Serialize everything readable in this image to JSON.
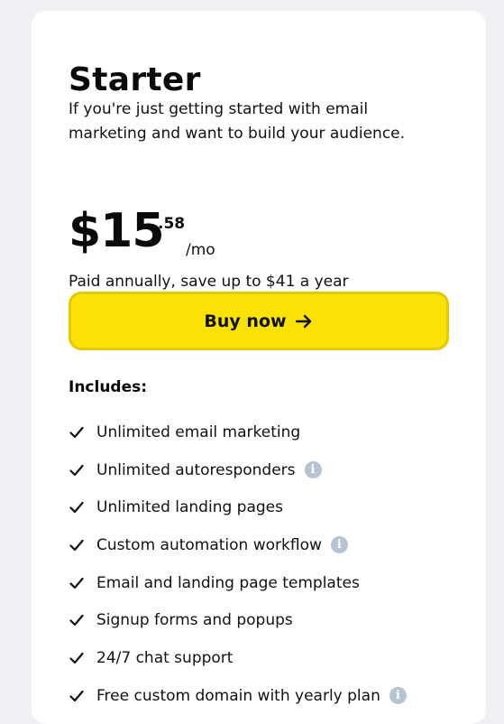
{
  "plan": {
    "title": "Starter",
    "description": "If you're just getting started with email marketing and want to build your audience.",
    "price": {
      "currency_and_integer": "$15",
      "cents": ".58",
      "period": "/mo"
    },
    "billing_note": "Paid annually, save up to $41 a year",
    "buy_label": "Buy now",
    "includes_heading": "Includes:",
    "features": [
      {
        "label": "Unlimited email marketing",
        "has_info": false
      },
      {
        "label": "Unlimited autoresponders",
        "has_info": true
      },
      {
        "label": "Unlimited landing pages",
        "has_info": false
      },
      {
        "label": "Custom automation workflow",
        "has_info": true
      },
      {
        "label": "Email and landing page templates",
        "has_info": false
      },
      {
        "label": "Signup forms and popups",
        "has_info": false
      },
      {
        "label": "24/7 chat support",
        "has_info": false
      },
      {
        "label": "Free custom domain with yearly plan",
        "has_info": true
      }
    ]
  },
  "icons": {
    "check": "check-icon",
    "info": "info-icon",
    "arrow": "arrow-right-icon"
  },
  "colors": {
    "page_background": "#eef0f3",
    "card_background": "#ffffff",
    "button_fill": "#fae106",
    "button_border": "#e0cb06",
    "info_icon": "#b5c3d2",
    "text": "#111111"
  }
}
